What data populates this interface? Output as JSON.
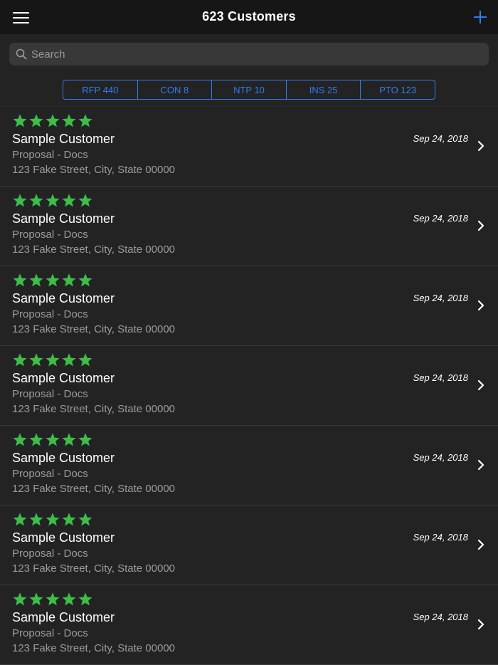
{
  "header": {
    "title": "623 Customers",
    "menu_icon": "hamburger-menu-icon",
    "add_icon": "plus-icon"
  },
  "search": {
    "placeholder": "Search",
    "value": "",
    "icon": "search-icon"
  },
  "filters": [
    {
      "label": "RFP 440"
    },
    {
      "label": "CON 8"
    },
    {
      "label": "NTP 10"
    },
    {
      "label": "INS 25"
    },
    {
      "label": "PTO 123"
    }
  ],
  "customers": [
    {
      "rating": 5,
      "name": "Sample Customer",
      "stage": "Proposal - Docs",
      "address": "123 Fake Street, City, State 00000",
      "date": "Sep 24, 2018"
    },
    {
      "rating": 5,
      "name": "Sample Customer",
      "stage": "Proposal - Docs",
      "address": "123 Fake Street, City, State 00000",
      "date": "Sep 24, 2018"
    },
    {
      "rating": 5,
      "name": "Sample Customer",
      "stage": "Proposal - Docs",
      "address": "123 Fake Street, City, State 00000",
      "date": "Sep 24, 2018"
    },
    {
      "rating": 5,
      "name": "Sample Customer",
      "stage": "Proposal - Docs",
      "address": "123 Fake Street, City, State 00000",
      "date": "Sep 24, 2018"
    },
    {
      "rating": 5,
      "name": "Sample Customer",
      "stage": "Proposal - Docs",
      "address": "123 Fake Street, City, State 00000",
      "date": "Sep 24, 2018"
    },
    {
      "rating": 5,
      "name": "Sample Customer",
      "stage": "Proposal - Docs",
      "address": "123 Fake Street, City, State 00000",
      "date": "Sep 24, 2018"
    },
    {
      "rating": 5,
      "name": "Sample Customer",
      "stage": "Proposal - Docs",
      "address": "123 Fake Street, City, State 00000",
      "date": "Sep 24, 2018"
    }
  ],
  "colors": {
    "background": "#232323",
    "navbar": "#161616",
    "accent": "#2e7cf6",
    "star": "#3dbd4a",
    "secondary_text": "#9b9b9b"
  }
}
